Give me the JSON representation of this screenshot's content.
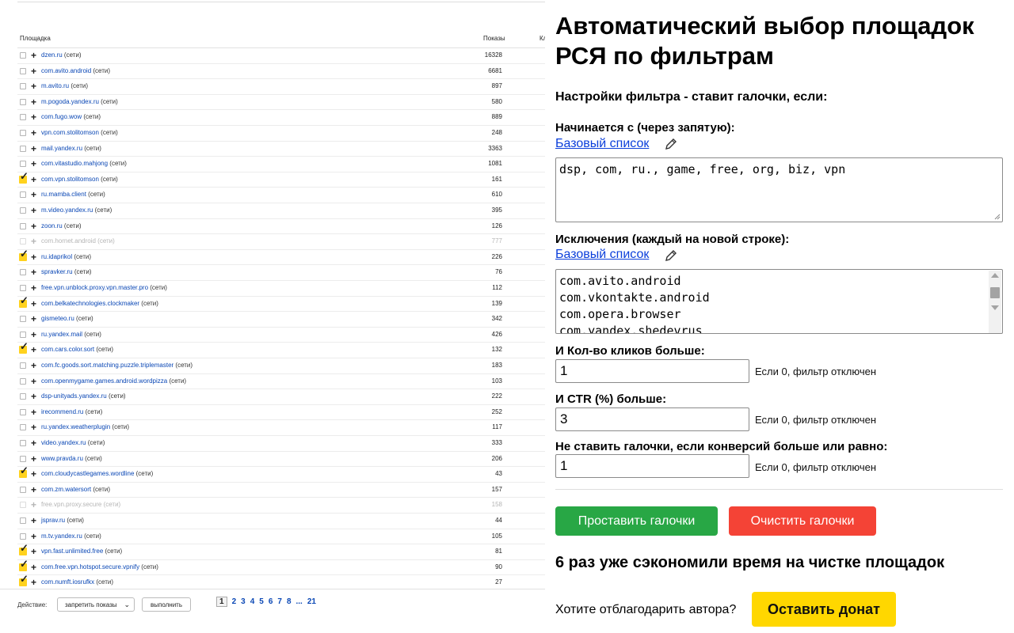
{
  "table": {
    "col_site": "Площадка",
    "col_shows": "Показы",
    "col_clicks_cut": "Кл",
    "rows": [
      {
        "site": "dzen.ru",
        "net": "(сети)",
        "shows": "16328",
        "checked": false,
        "dim": false
      },
      {
        "site": "com.avito.android",
        "net": "(сети)",
        "shows": "6681",
        "checked": false,
        "dim": false
      },
      {
        "site": "m.avito.ru",
        "net": "(сети)",
        "shows": "897",
        "checked": false,
        "dim": false
      },
      {
        "site": "m.pogoda.yandex.ru",
        "net": "(сети)",
        "shows": "580",
        "checked": false,
        "dim": false
      },
      {
        "site": "com.fugo.wow",
        "net": "(сети)",
        "shows": "889",
        "checked": false,
        "dim": false
      },
      {
        "site": "vpn.com.stolitomson",
        "net": "(сети)",
        "shows": "248",
        "checked": false,
        "dim": false
      },
      {
        "site": "mail.yandex.ru",
        "net": "(сети)",
        "shows": "3363",
        "checked": false,
        "dim": false
      },
      {
        "site": "com.vitastudio.mahjong",
        "net": "(сети)",
        "shows": "1081",
        "checked": false,
        "dim": false
      },
      {
        "site": "com.vpn.stolitomson",
        "net": "(сети)",
        "shows": "161",
        "checked": true,
        "dim": false
      },
      {
        "site": "ru.mamba.client",
        "net": "(сети)",
        "shows": "610",
        "checked": false,
        "dim": false
      },
      {
        "site": "m.video.yandex.ru",
        "net": "(сети)",
        "shows": "395",
        "checked": false,
        "dim": false
      },
      {
        "site": "zoon.ru",
        "net": "(сети)",
        "shows": "126",
        "checked": false,
        "dim": false
      },
      {
        "site": "com.hornet.android",
        "net": "(сети)",
        "shows": "777",
        "checked": false,
        "dim": true
      },
      {
        "site": "ru.idaprikol",
        "net": "(сети)",
        "shows": "226",
        "checked": true,
        "dim": false
      },
      {
        "site": "spravker.ru",
        "net": "(сети)",
        "shows": "76",
        "checked": false,
        "dim": false
      },
      {
        "site": "free.vpn.unblock.proxy.vpn.master.pro",
        "net": "(сети)",
        "shows": "112",
        "checked": false,
        "dim": false
      },
      {
        "site": "com.belkatechnologies.clockmaker",
        "net": "(сети)",
        "shows": "139",
        "checked": true,
        "dim": false
      },
      {
        "site": "gismeteo.ru",
        "net": "(сети)",
        "shows": "342",
        "checked": false,
        "dim": false
      },
      {
        "site": "ru.yandex.mail",
        "net": "(сети)",
        "shows": "426",
        "checked": false,
        "dim": false
      },
      {
        "site": "com.cars.color.sort",
        "net": "(сети)",
        "shows": "132",
        "checked": true,
        "dim": false
      },
      {
        "site": "com.fc.goods.sort.matching.puzzle.triplemaster",
        "net": "(сети)",
        "shows": "183",
        "checked": false,
        "dim": false
      },
      {
        "site": "com.openmygame.games.android.wordpizza",
        "net": "(сети)",
        "shows": "103",
        "checked": false,
        "dim": false
      },
      {
        "site": "dsp-unityads.yandex.ru",
        "net": "(сети)",
        "shows": "222",
        "checked": false,
        "dim": false
      },
      {
        "site": "irecommend.ru",
        "net": "(сети)",
        "shows": "252",
        "checked": false,
        "dim": false
      },
      {
        "site": "ru.yandex.weatherplugin",
        "net": "(сети)",
        "shows": "117",
        "checked": false,
        "dim": false
      },
      {
        "site": "video.yandex.ru",
        "net": "(сети)",
        "shows": "333",
        "checked": false,
        "dim": false
      },
      {
        "site": "www.pravda.ru",
        "net": "(сети)",
        "shows": "206",
        "checked": false,
        "dim": false
      },
      {
        "site": "com.cloudycastlegames.wordline",
        "net": "(сети)",
        "shows": "43",
        "checked": true,
        "dim": false
      },
      {
        "site": "com.zm.watersort",
        "net": "(сети)",
        "shows": "157",
        "checked": false,
        "dim": false
      },
      {
        "site": "free.vpn.proxy.secure",
        "net": "(сети)",
        "shows": "158",
        "checked": false,
        "dim": true
      },
      {
        "site": "jsprav.ru",
        "net": "(сети)",
        "shows": "44",
        "checked": false,
        "dim": false
      },
      {
        "site": "m.tv.yandex.ru",
        "net": "(сети)",
        "shows": "105",
        "checked": false,
        "dim": false
      },
      {
        "site": "vpn.fast.unlimited.free",
        "net": "(сети)",
        "shows": "81",
        "checked": true,
        "dim": false
      },
      {
        "site": "com.free.vpn.hotspot.secure.vpnify",
        "net": "(сети)",
        "shows": "90",
        "checked": true,
        "dim": false
      },
      {
        "site": "com.numft.iosrufkx",
        "net": "(сети)",
        "shows": "27",
        "checked": true,
        "dim": false
      }
    ]
  },
  "bottom": {
    "action_label": "Действие:",
    "action_select": "запретить показы",
    "execute": "выполнить",
    "pages": [
      "1",
      "2",
      "3",
      "4",
      "5",
      "6",
      "7",
      "8",
      "...",
      "21"
    ],
    "current_page": "1"
  },
  "panel": {
    "title": "Автоматический выбор площадок РСЯ по фильтрам",
    "settings_heading": "Настройки фильтра - ставит галочки, если:",
    "starts_label": "Начинается с (через запятую):",
    "base_list_link": "Базовый список",
    "starts_value": "dsp, com, ru., game, free, org, biz, vpn",
    "exclusions_label": "Исключения (каждый на новой строке):",
    "exclusions_value": "com.avito.android\ncom.vkontakte.android\ncom.opera.browser\ncom.yandex.shedevrus",
    "clicks_label": "И Кол-во кликов больше:",
    "clicks_value": "1",
    "ctr_label": "И CTR (%) больше:",
    "ctr_value": "3",
    "conv_label": "Не ставить галочки, если конверсий больше или равно:",
    "conv_value": "1",
    "disabled_hint": "Если 0, фильтр отключен",
    "btn_set": "Проставить галочки",
    "btn_clear": "Очистить галочки",
    "saved_text": "6 раз уже сэкономили время на чистке площадок",
    "thanks_text": "Хотите отблагодарить автора?",
    "donate": "Оставить донат"
  },
  "colors": {
    "link": "#0a47b5",
    "green": "#28a745",
    "red": "#f44336",
    "donate": "#ffd700",
    "check": "#ffd21e"
  }
}
